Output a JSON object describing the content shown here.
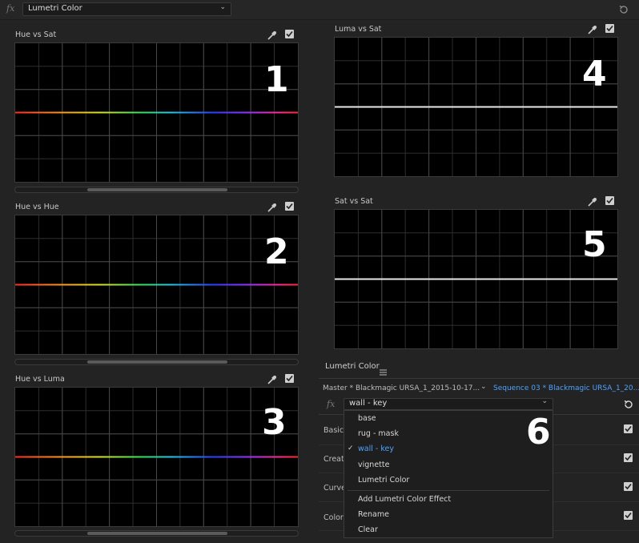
{
  "top": {
    "fx": "fx",
    "effect_select": "Lumetri Color"
  },
  "curves": {
    "hue_vs_sat": {
      "title": "Hue vs Sat",
      "marker": "1"
    },
    "hue_vs_hue": {
      "title": "Hue vs Hue",
      "marker": "2"
    },
    "hue_vs_luma": {
      "title": "Hue vs Luma",
      "marker": "3"
    },
    "luma_vs_sat": {
      "title": "Luma vs Sat",
      "marker": "4"
    },
    "sat_vs_sat": {
      "title": "Sat vs Sat",
      "marker": "5"
    }
  },
  "lumetri_panel": {
    "title": "Lumetri Color",
    "menu_icon": "hamburger-icon",
    "master": "Master * Blackmagic URSA_1_2015-10-17...",
    "sequence": "Sequence 03 * Blackmagic URSA_1_20...",
    "fx": "fx",
    "layer_select": "wall - key",
    "marker": "6",
    "sections": [
      "Basic",
      "Creat",
      "Curve",
      "Color"
    ]
  },
  "dropdown": {
    "items": [
      "base",
      "rug - mask",
      "wall - key",
      "vignette",
      "Lumetri Color"
    ],
    "selected": "wall - key",
    "actions": [
      "Add Lumetri Color Effect",
      "Rename",
      "Clear"
    ]
  },
  "colors": {
    "background": "#232323",
    "graph_background": "#000000",
    "accent_blue": "#4da3ff"
  }
}
